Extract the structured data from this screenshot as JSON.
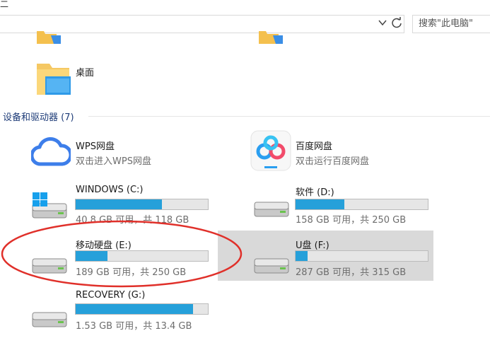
{
  "window": {
    "top_fragment": "二"
  },
  "address_bar": {
    "path": "",
    "refresh_icon": "refresh-icon",
    "dropdown_icon": "chevron-down-icon"
  },
  "search": {
    "placeholder": "搜索\"此电脑\""
  },
  "folders": {
    "desktop_label": "桌面"
  },
  "devices": {
    "group_label": "设备和驱动器 (7)",
    "items": [
      {
        "name": "WPS网盘",
        "subtitle": "双击进入WPS网盘",
        "type": "cloud"
      },
      {
        "name": "百度网盘",
        "subtitle": "双击运行百度网盘",
        "type": "cloud"
      },
      {
        "name": "WINDOWS (C:)",
        "usage": "40.8 GB 可用，共 118 GB",
        "used_fraction": 0.65
      },
      {
        "name": "软件 (D:)",
        "usage": "158 GB 可用，共 250 GB",
        "used_fraction": 0.37
      },
      {
        "name": "移动硬盘 (E:)",
        "usage": "189 GB 可用，共 250 GB",
        "used_fraction": 0.24
      },
      {
        "name": "U盘 (F:)",
        "usage": "287 GB 可用，共 315 GB",
        "used_fraction": 0.09,
        "selected": true
      },
      {
        "name": "RECOVERY (G:)",
        "usage": "1.53 GB 可用，共 13.4 GB",
        "used_fraction": 0.89
      }
    ]
  },
  "colors": {
    "bar_fill": "#26a0da",
    "bar_track": "#e6e6e6",
    "selection": "#d9d9d9",
    "annotation": "#e0302a",
    "group_header": "#1e3c78"
  }
}
